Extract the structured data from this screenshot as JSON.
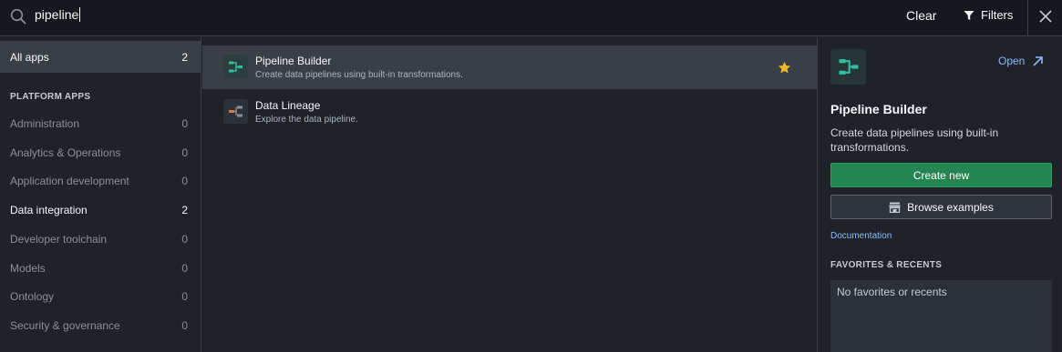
{
  "search": {
    "value": "pipeline"
  },
  "toolbar": {
    "clear_label": "Clear",
    "filters_label": "Filters"
  },
  "sidebar": {
    "all_apps": {
      "label": "All apps",
      "count": "2"
    },
    "heading": "PLATFORM APPS",
    "items": [
      {
        "label": "Administration",
        "count": "0"
      },
      {
        "label": "Analytics & Operations",
        "count": "0"
      },
      {
        "label": "Application development",
        "count": "0"
      },
      {
        "label": "Data integration",
        "count": "2"
      },
      {
        "label": "Developer toolchain",
        "count": "0"
      },
      {
        "label": "Models",
        "count": "0"
      },
      {
        "label": "Ontology",
        "count": "0"
      },
      {
        "label": "Security & governance",
        "count": "0"
      }
    ]
  },
  "results": [
    {
      "title": "Pipeline Builder",
      "description": "Create data pipelines using built-in transformations.",
      "favorite": true
    },
    {
      "title": "Data Lineage",
      "description": "Explore the data pipeline.",
      "favorite": false
    }
  ],
  "detail": {
    "open_label": "Open",
    "title": "Pipeline Builder",
    "description": "Create data pipelines using built-in transformations.",
    "create_label": "Create new",
    "browse_label": "Browse examples",
    "documentation_label": "Documentation",
    "favorites_heading": "FAVORITES & RECENTS",
    "favorites_empty": "No favorites or recents"
  },
  "colors": {
    "accent_green": "#238551",
    "link_blue": "#8abbff",
    "star_gold": "#f0b726",
    "pipeline_teal": "#2fbfa3"
  }
}
